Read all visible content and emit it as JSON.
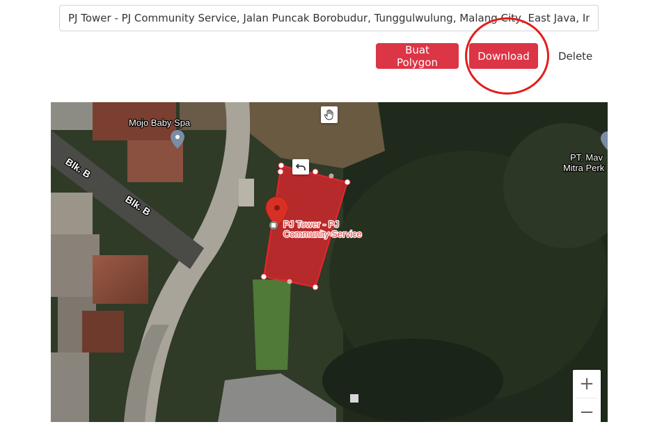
{
  "search": {
    "value": "PJ Tower - PJ Community Service, Jalan Puncak Borobudur, Tunggulwulung, Malang City, East Java, Indonesia"
  },
  "toolbar": {
    "polygon_label": "Buat Polygon",
    "download_label": "Download",
    "delete_label": "Delete"
  },
  "colors": {
    "button": "#dc3545",
    "highlight": "#e31b1b",
    "polygon_fill": "#e5262d"
  },
  "map": {
    "labels": {
      "mojo": "Mojo Baby Spa",
      "pt_line1": "PT. Mav",
      "pt_line2": "Mitra Perk",
      "road1": "Blk. B",
      "road2": "Blk. B",
      "pj_line1": "PJ Tower - PJ",
      "pj_line2": "Community Service"
    },
    "controls": {
      "zoom_in": "+",
      "zoom_out": "−",
      "hand_icon": "hand-icon",
      "undo_icon": "undo-icon"
    }
  }
}
